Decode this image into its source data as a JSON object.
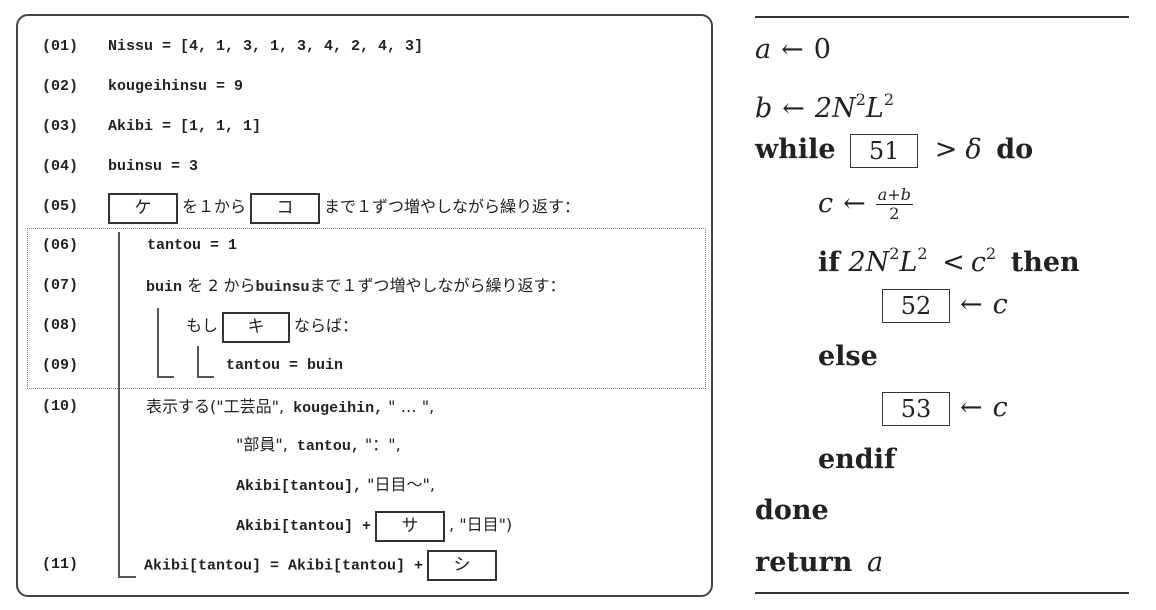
{
  "left_panel": {
    "lines": [
      {
        "num": "(01)",
        "code": "Nissu = [4, 1, 3, 1, 3, 4, 2, 4, 3]"
      },
      {
        "num": "(02)",
        "code": "kougeihinsu = 9"
      },
      {
        "num": "(03)",
        "code": "Akibi = [1, 1, 1]"
      },
      {
        "num": "(04)",
        "code": "buinsu = 3"
      },
      {
        "num": "(05)",
        "blank1": "ケ",
        "t1": "を１から",
        "blank2": "コ",
        "t2": "まで１ずつ増やしながら繰り返す："
      },
      {
        "num": "(06)",
        "code": "tantou = 1"
      },
      {
        "num": "(07)",
        "c1": "buin",
        "t1": " を 2 から",
        "c2": "buinsu",
        "t2": "まで１ずつ増やしながら繰り返す："
      },
      {
        "num": "(08)",
        "t1": "もし",
        "blank": "キ",
        "t2": "ならば："
      },
      {
        "num": "(09)",
        "code": "tantou = buin"
      },
      {
        "num": "(10)",
        "t1": "表示する(\"工芸品\",",
        "c1": " kougeihin,",
        "t2": " \" … \","
      },
      {
        "t1": "\"部員\",",
        "c1": " tantou,",
        "t2": " \"：\","
      },
      {
        "c1": "Akibi[tantou],",
        "t2": " \"日目～\","
      },
      {
        "c1": "Akibi[tantou] +",
        "blank": "サ",
        "t2": ", \"日目\")"
      },
      {
        "num": "(11)",
        "c1": "Akibi[tantou] = Akibi[tantou] +",
        "blank": "シ"
      }
    ]
  },
  "right_panel": {
    "lines": [
      {
        "var": "a",
        "arrow": "←",
        "value": "0"
      },
      {
        "var": "b",
        "arrow": "←",
        "value": "2N",
        "sup1": "2",
        "value2": "L",
        "sup2": "2"
      },
      {
        "kw1": "while",
        "box": "51",
        "op": ">",
        "sym": "δ",
        "kw2": "do"
      },
      {
        "var": "c",
        "arrow": "←",
        "frac_num": "a+b",
        "frac_den": "2"
      },
      {
        "kw1": "if",
        "lhs": "2N",
        "sup1": "2",
        "lhs2": "L",
        "sup2": "2",
        "op": "<",
        "rhs": "c",
        "sup3": "2",
        "kw2": "then"
      },
      {
        "box": "52",
        "arrow": "←",
        "var": "c"
      },
      {
        "kw": "else"
      },
      {
        "box": "53",
        "arrow": "←",
        "var": "c"
      },
      {
        "kw": "endif"
      },
      {
        "kw": "done"
      },
      {
        "kw": "return",
        "var": "a"
      }
    ]
  }
}
